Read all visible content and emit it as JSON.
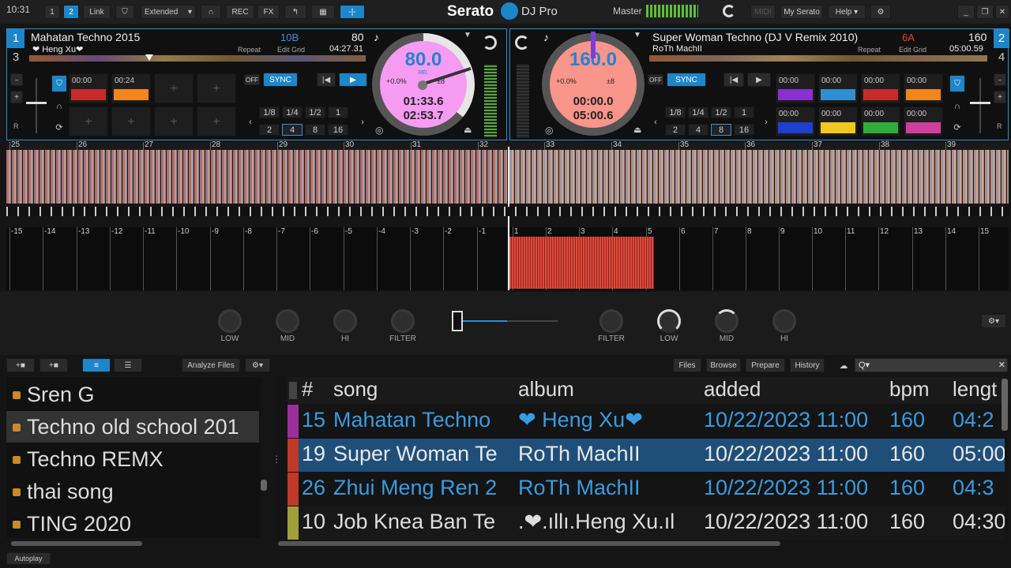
{
  "top": {
    "time": "10:31",
    "deck1": "1",
    "deck2": "2",
    "link": "Link",
    "layout": "Extended",
    "rec": "REC",
    "fx": "FX",
    "brand": "Serato",
    "product": "DJ Pro",
    "master": "Master",
    "midi": "MIDI",
    "my_serato": "My Serato",
    "help": "Help"
  },
  "deck_left": {
    "num_top": "1",
    "num_bottom": "3",
    "title": "Mahatan Techno 2015",
    "artist": "❤ Heng Xu❤",
    "key": "10B",
    "bpm": "80",
    "repeat": "Repeat",
    "edit_grid": "Edit Grid",
    "total": "04:27.31",
    "platter_bpm": "80.0",
    "rel": "REL",
    "pitch": "+0.0%",
    "range": "±8",
    "elapsed": "01:33.6",
    "remain": "02:53.7",
    "cue1": "00:00",
    "cue2": "00:24",
    "sync_off": "OFF",
    "sync": "SYNC",
    "loops": [
      "1/8",
      "1/4",
      "1/2",
      "1",
      "2",
      "4",
      "8",
      "16"
    ]
  },
  "deck_right": {
    "num_top": "2",
    "num_bottom": "4",
    "title": "Super Woman Techno (DJ V Remix 2010)",
    "artist": "RoTh MachII",
    "key": "6A",
    "bpm": "160",
    "repeat": "Repeat",
    "edit_grid": "Edit Grid",
    "total": "05:00.59",
    "platter_bpm": "160.0",
    "pitch": "+0.0%",
    "range": "±8",
    "elapsed": "00:00.0",
    "remain": "05:00.6",
    "cues": [
      "00:00",
      "00:00",
      "00:00",
      "00:00",
      "00:00",
      "00:00",
      "00:00",
      "00:00"
    ],
    "sync_off": "OFF",
    "sync": "SYNC",
    "loops": [
      "1/8",
      "1/4",
      "1/2",
      "1",
      "2",
      "4",
      "8",
      "16"
    ]
  },
  "beats_top": [
    "25",
    "26",
    "27",
    "28",
    "29",
    "30",
    "31",
    "32",
    "33",
    "34",
    "35",
    "36",
    "37",
    "38",
    "39"
  ],
  "beats_left": [
    "-15",
    "-14",
    "-13",
    "-12",
    "-11",
    "-10",
    "-9",
    "-8",
    "-7",
    "-6",
    "-5",
    "-4",
    "-3",
    "-2",
    "-1"
  ],
  "beats_right": [
    "1",
    "2",
    "3",
    "4",
    "5",
    "6",
    "7",
    "8",
    "9",
    "10",
    "11",
    "12",
    "13",
    "14",
    "15"
  ],
  "mixer": {
    "low": "LOW",
    "mid": "MID",
    "hi": "HI",
    "filter": "FILTER"
  },
  "library": {
    "analyze": "Analyze Files",
    "files": "Files",
    "browse": "Browse",
    "prepare": "Prepare",
    "history": "History",
    "autoplay": "Autoplay",
    "search_icon": "Q▾",
    "crates": [
      "Sren G",
      "Techno old school 201",
      "Techno REMX",
      "thai song",
      "TING 2020"
    ],
    "columns": {
      "num": "#",
      "song": "song",
      "album": "album",
      "added": "added",
      "bpm": "bpm",
      "length": "lengt"
    },
    "tracks": [
      {
        "num": "15",
        "song": "Mahatan Techno",
        "album": "❤ Heng Xu❤",
        "added": "10/22/2023 11:00",
        "bpm": "160",
        "length": "04:2",
        "color": "#9b2f9b"
      },
      {
        "num": "19",
        "song": "Super Woman Te",
        "album": "RoTh MachII",
        "added": "10/22/2023 11:00",
        "bpm": "160",
        "length": "05:00",
        "color": "#c0392b"
      },
      {
        "num": "26",
        "song": "Zhui Meng Ren 2",
        "album": "RoTh MachII",
        "added": "10/22/2023 11:00",
        "bpm": "160",
        "length": "04:3",
        "color": "#c0392b"
      },
      {
        "num": "10",
        "song": "Job Knea Ban Te",
        "album": ".❤.ıllı.Heng Xu.ıl",
        "added": "10/22/2023 11:00",
        "bpm": "160",
        "length": "04:30",
        "color": "#9fa03a"
      }
    ]
  }
}
